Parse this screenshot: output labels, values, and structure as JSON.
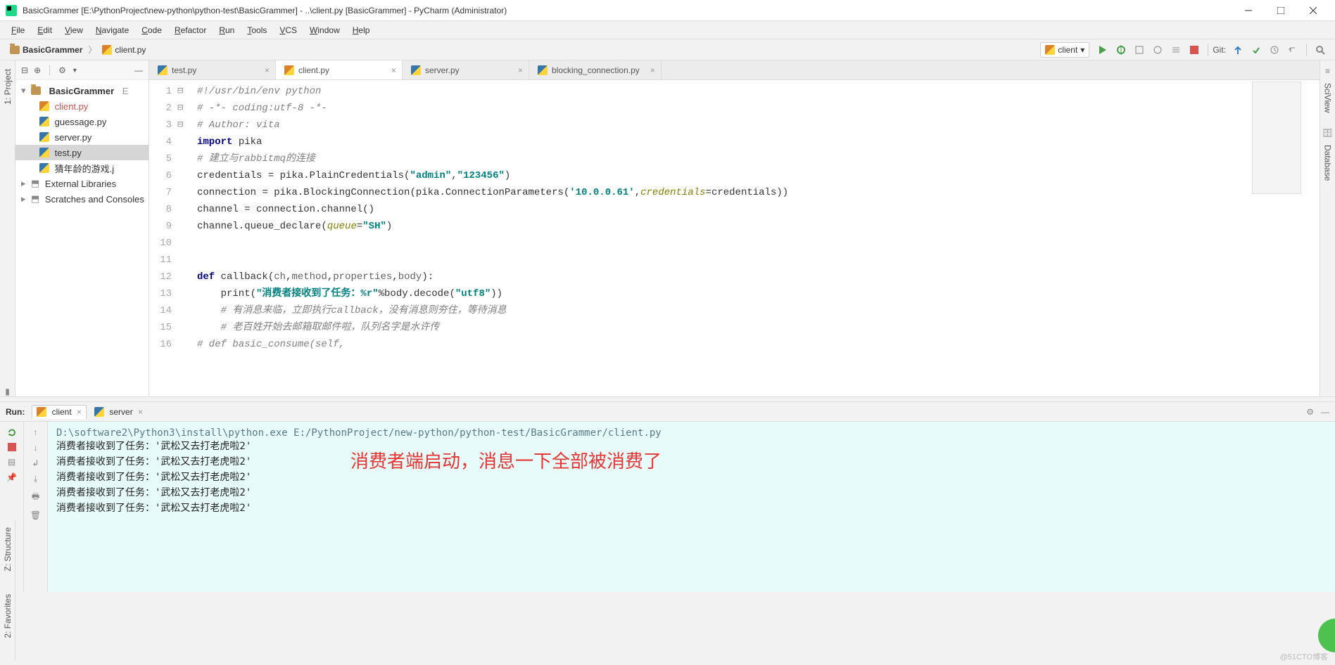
{
  "window": {
    "title": "BasicGrammer [E:\\PythonProject\\new-python\\python-test\\BasicGrammer] - ..\\client.py [BasicGrammer] - PyCharm (Administrator)"
  },
  "menu": [
    "File",
    "Edit",
    "View",
    "Navigate",
    "Code",
    "Refactor",
    "Run",
    "Tools",
    "VCS",
    "Window",
    "Help"
  ],
  "breadcrumb": {
    "root": "BasicGrammer",
    "file": "client.py"
  },
  "run_config": "client",
  "git_label": "Git:",
  "project_tree": {
    "root": "BasicGrammer",
    "root_hint": "E",
    "files": [
      "client.py",
      "guessage.py",
      "server.py",
      "test.py",
      "猜年龄的游戏.j"
    ],
    "nodes": [
      "External Libraries",
      "Scratches and Consoles"
    ]
  },
  "left_tool": {
    "project": "1: Project"
  },
  "right_tool": {
    "sciview": "SciView",
    "database": "Database"
  },
  "bottom_tool": {
    "structure": "Z: Structure",
    "favorites": "2: Favorites"
  },
  "tabs": [
    {
      "name": "test.py",
      "active": false
    },
    {
      "name": "client.py",
      "active": true
    },
    {
      "name": "server.py",
      "active": false
    },
    {
      "name": "blocking_connection.py",
      "active": false
    }
  ],
  "code": {
    "lines": [
      {
        "n": 1,
        "raw": "#!/usr/bin/env python",
        "cls": "c-comment"
      },
      {
        "n": 2,
        "raw": "# -*- coding:utf-8 -*-",
        "cls": "c-comment"
      },
      {
        "n": 3,
        "raw": "# Author: vita",
        "cls": "c-comment"
      },
      {
        "n": 4,
        "html": "<span class='c-key'>import</span> pika"
      },
      {
        "n": 5,
        "raw": "# 建立与rabbitmq的连接",
        "cls": "c-comment"
      },
      {
        "n": 6,
        "html": "credentials = pika.PlainCredentials(<span class='c-str'>\"admin\"</span>,<span class='c-str'>\"123456\"</span>)"
      },
      {
        "n": 7,
        "html": "connection = pika.BlockingConnection(pika.ConnectionParameters(<span class='c-str'>'10.0.0.61'</span>,<span class='c-named'>credentials</span>=credentials))"
      },
      {
        "n": 8,
        "html": "channel = connection.channel()"
      },
      {
        "n": 9,
        "html": "channel.queue_declare(<span class='c-named'>queue</span>=<span class='c-str'>\"SH\"</span>)"
      },
      {
        "n": 10,
        "raw": ""
      },
      {
        "n": 11,
        "raw": ""
      },
      {
        "n": 12,
        "html": "<span class='c-key'>def</span> callback(<span class='c-id'>ch</span>,<span class='c-id'>method</span>,<span class='c-id'>properties</span>,<span class='c-id'>body</span>):"
      },
      {
        "n": 13,
        "html": "    print(<span class='c-str'>\"消费者接收到了任务：%r\"</span>%body.decode(<span class='c-str'>\"utf8\"</span>))"
      },
      {
        "n": 14,
        "raw": "    # 有消息来临，立即执行callback，没有消息则夯住，等待消息",
        "cls": "c-comment"
      },
      {
        "n": 15,
        "raw": "    # 老百姓开始去邮箱取邮件啦，队列名字是水许传",
        "cls": "c-comment"
      },
      {
        "n": 16,
        "raw": "# def basic_consume(self,",
        "cls": "c-comment"
      }
    ]
  },
  "run_panel": {
    "label": "Run:",
    "tabs": [
      {
        "name": "client",
        "active": true
      },
      {
        "name": "server",
        "active": false
      }
    ],
    "command": "D:\\software2\\Python3\\install\\python.exe E:/PythonProject/new-python/python-test/BasicGrammer/client.py",
    "output_lines": [
      "消费者接收到了任务：'武松又去打老虎啦2'",
      "消费者接收到了任务：'武松又去打老虎啦2'",
      "消费者接收到了任务：'武松又去打老虎啦2'",
      "消费者接收到了任务：'武松又去打老虎啦2'",
      "消费者接收到了任务：'武松又去打老虎啦2'"
    ],
    "annotation": "消费者端启动，消息一下全部被消费了"
  },
  "watermark": "@51CTO博客"
}
